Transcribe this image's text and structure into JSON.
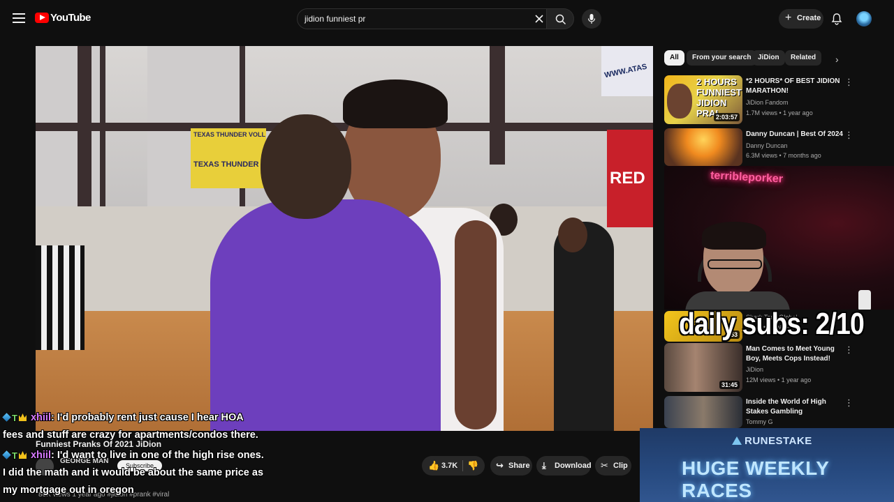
{
  "header": {
    "logo_text": "YouTube",
    "search_value": "jidion funniest pr",
    "create_label": "Create"
  },
  "video": {
    "title": "Funniest Pranks Of 2021 JiDion",
    "channel": "GEORGE MAN",
    "subscribe_label": "Subscribe",
    "likes": "3.7K",
    "share_label": "Share",
    "download_label": "Download",
    "clip_label": "Clip",
    "description_line": "80K views  1 year ago  #jidion #prank #viral",
    "scene_text": {
      "banner_yellow": "TEXAS THUNDER VOLL",
      "banner_yellow_sub": "TEXAS THUNDER",
      "banner_red": "RED",
      "banner_white": "WWW.ATAS"
    }
  },
  "chips": [
    "All",
    "From your search",
    "JiDion",
    "Related"
  ],
  "recommendations": [
    {
      "title": "*2 HOURS* OF BEST JIDION MARATHON!",
      "channel": "JiDion Fandom",
      "meta": "1.7M views • 1 year ago",
      "duration": "2:03:57",
      "thumb_text": "2 HOURS FUNNIEST JIDION PRAI"
    },
    {
      "title": "Danny Duncan | Best Of 2024",
      "channel": "Danny Duncan",
      "meta": "6.3M views • 7 months ago"
    },
    {
      "title": "Shark Tank Global",
      "channel": "Shark Tank Global",
      "meta": "views • 1 year ago",
      "duration": "53"
    },
    {
      "title": "Man Comes to Meet Young Boy, Meets Cops Instead!",
      "channel": "JiDion",
      "meta": "12M views • 1 year ago",
      "duration": "31:45"
    },
    {
      "title": "Inside the World of High Stakes Gambling",
      "channel": "Tommy G",
      "meta": ""
    }
  ],
  "webcam": {
    "neon_sign": "terribleporker",
    "subs_goal": "daily subs: 2/10"
  },
  "ad": {
    "brand": "RUNESTAKE",
    "headline": "HUGE WEEKLY RACES"
  },
  "chat": [
    {
      "user": "xhiil",
      "text": ": I'd probably rent just cause I hear HOA"
    },
    {
      "cont": "fees and stuff are crazy for apartments/condos there."
    },
    {
      "user": "xhiil",
      "text": ": I'd want to live in one of the high rise ones."
    },
    {
      "cont": "I did the math and it would be about the same price as"
    },
    {
      "cont": "my mortgage out in oregon"
    }
  ],
  "colors": {
    "background": "#0f0f0f",
    "brand_red": "#ff0000",
    "chat_username": "#d77aff",
    "coach_shirt": "#6d3fbd",
    "ad_blue": "#274a80"
  }
}
